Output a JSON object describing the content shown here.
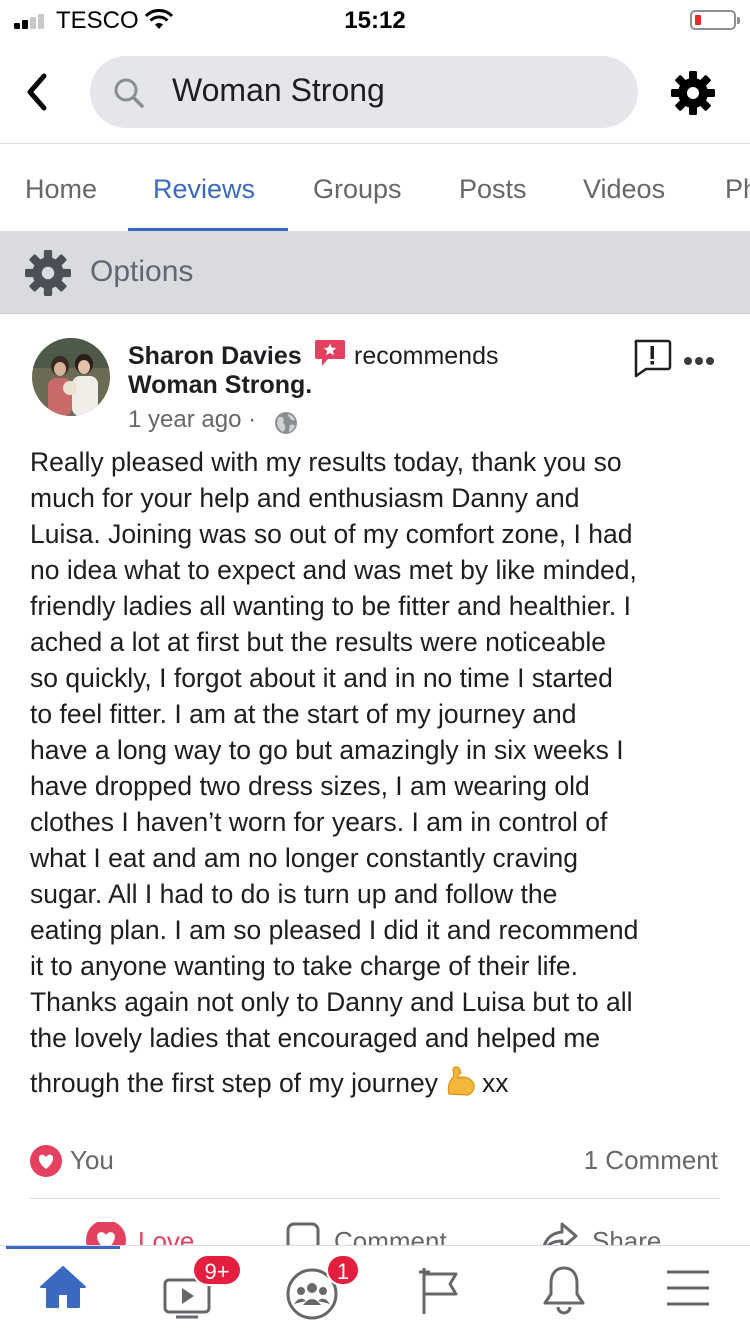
{
  "status_bar": {
    "carrier": "TESCO",
    "time": "15:12"
  },
  "search": {
    "query": "Woman Strong"
  },
  "tabs": [
    {
      "label": "Home"
    },
    {
      "label": "Reviews"
    },
    {
      "label": "Groups"
    },
    {
      "label": "Posts"
    },
    {
      "label": "Videos"
    },
    {
      "label": "Ph"
    }
  ],
  "options": {
    "label": "Options"
  },
  "post": {
    "author": "Sharon Davies",
    "verb": "recommends",
    "page": "Woman Strong.",
    "time": "1 year ago ·",
    "lines": [
      "Really pleased with my results today, thank you so",
      "much for your help and enthusiasm Danny and",
      "Luisa. Joining was so out of my comfort zone, I had",
      "no idea what to expect and was met by like minded,",
      "friendly ladies all wanting to be fitter and healthier. I",
      "ached a lot at first but the results were noticeable",
      "so quickly, I forgot about it and in no time I started",
      "to feel fitter. I am at the start of my journey and",
      "have a long way to go but amazingly in six weeks I",
      "have dropped two dress sizes, I am wearing old",
      "clothes I haven’t worn for years. I am in control of",
      "what I eat and am no longer constantly craving",
      "sugar. All I had to do is turn up and follow the",
      "eating plan. I am so pleased I did it and recommend",
      "it to anyone wanting to take charge of their life.",
      "Thanks again not only to Danny and Luisa but to all",
      "the lovely ladies that encouraged and helped me"
    ],
    "last_line_start": "through the first step of my journey",
    "last_line_end": "xx",
    "reactions": {
      "who": "You",
      "comments": "1 Comment"
    },
    "actions": {
      "love": "Love",
      "comment": "Comment",
      "share": "Share"
    }
  },
  "bottom_nav": {
    "watch_badge": "9+",
    "groups_badge": "1"
  },
  "colors": {
    "accent": "#3b69c2",
    "love": "#e4405f",
    "badge": "#e41e3f"
  }
}
